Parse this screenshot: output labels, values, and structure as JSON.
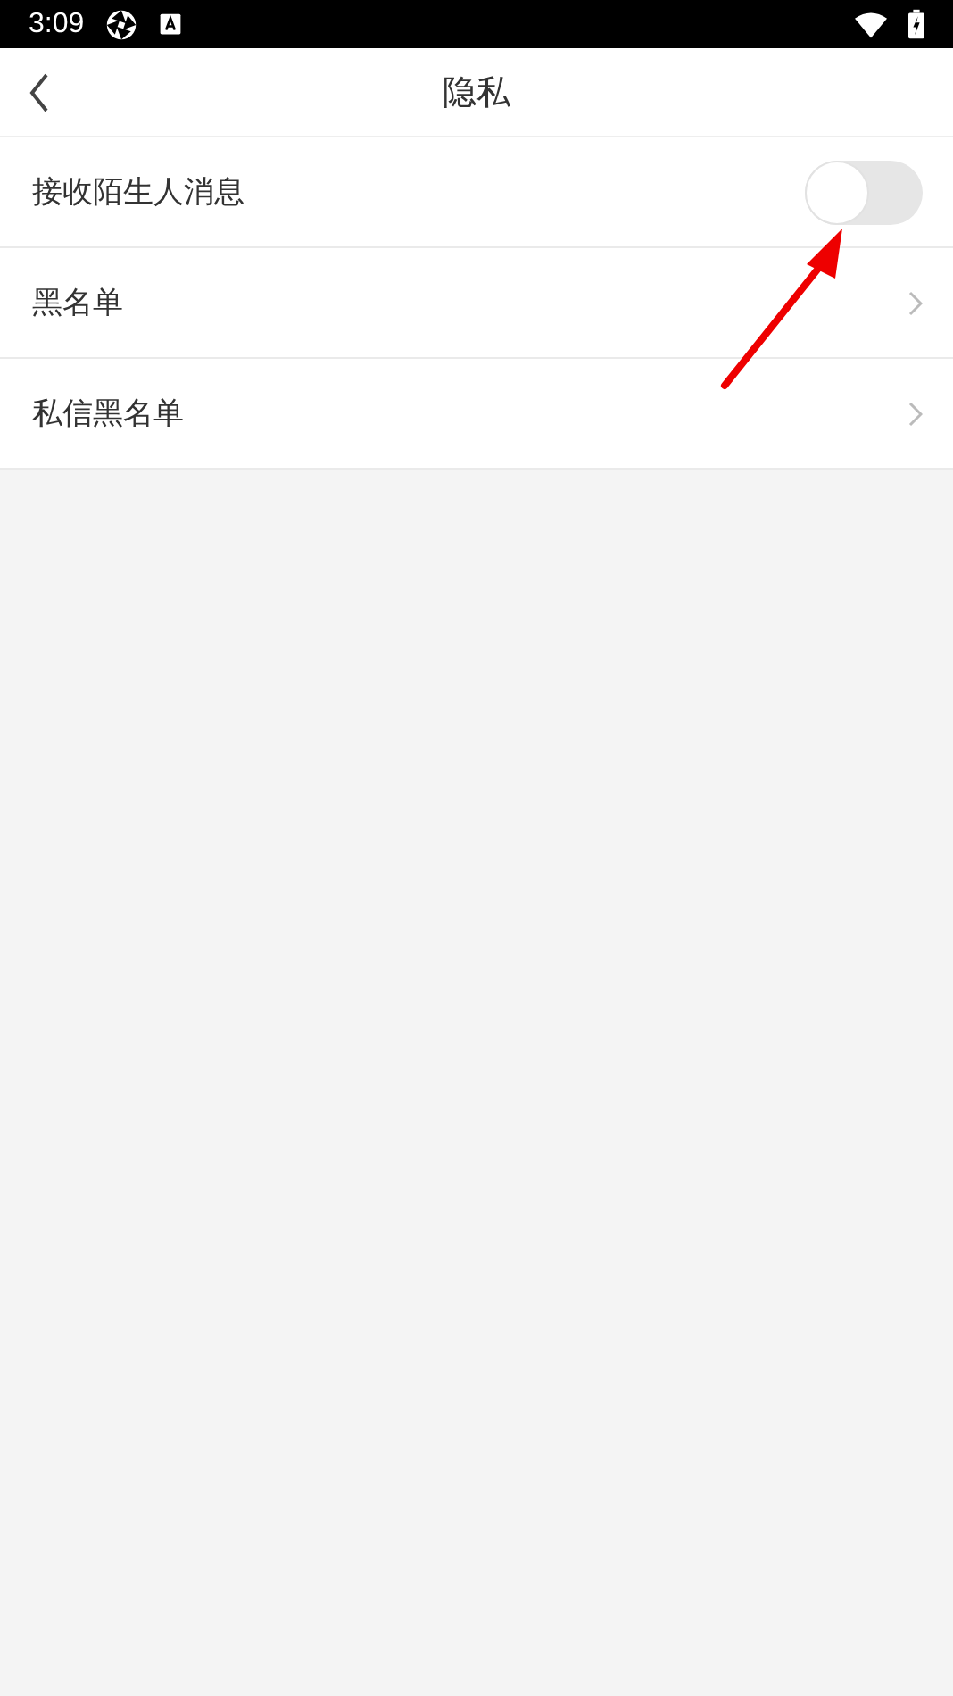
{
  "status_bar": {
    "time": "3:09"
  },
  "header": {
    "title": "隐私"
  },
  "rows": [
    {
      "kind": "toggle",
      "label": "接收陌生人消息",
      "on": false
    },
    {
      "kind": "link",
      "label": "黑名单"
    },
    {
      "kind": "link",
      "label": "私信黑名单"
    }
  ]
}
